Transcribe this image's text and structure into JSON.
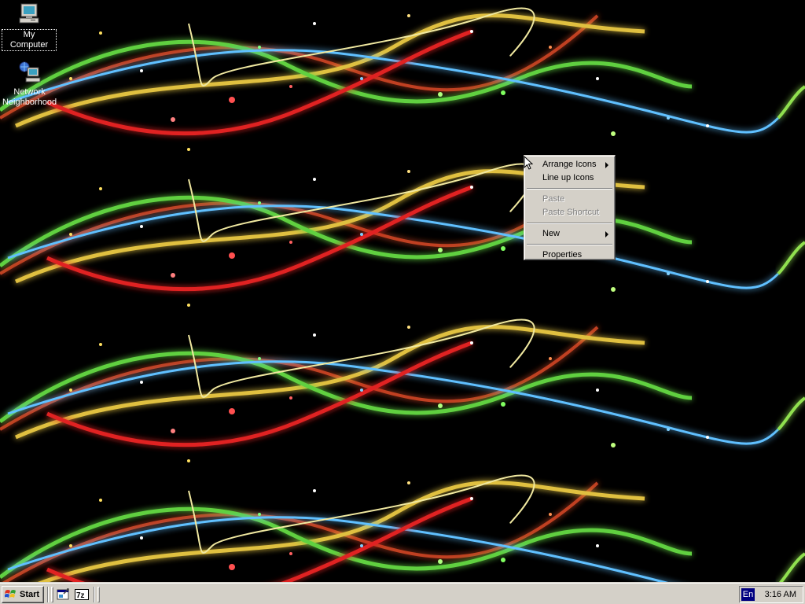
{
  "desktop": {
    "icons": [
      {
        "label": "My Computer",
        "icon": "my-computer-icon",
        "selected": true
      },
      {
        "label": "Network Neighborhood",
        "icon": "network-neighborhood-icon",
        "selected": false
      }
    ]
  },
  "context_menu": {
    "items": {
      "arrange_icons": {
        "label": "Arrange Icons",
        "submenu": true,
        "enabled": true
      },
      "line_up_icons": {
        "label": "Line up Icons",
        "enabled": true
      },
      "paste": {
        "label": "Paste",
        "enabled": false
      },
      "paste_shortcut": {
        "label": "Paste Shortcut",
        "enabled": false
      },
      "new": {
        "label": "New",
        "submenu": true,
        "enabled": true
      },
      "properties": {
        "label": "Properties",
        "enabled": true
      }
    }
  },
  "taskbar": {
    "start_label": "Start",
    "quick_launch": [
      {
        "icon": "show-desktop-icon"
      },
      {
        "icon": "7zip-icon",
        "label": "7z"
      }
    ],
    "tray": {
      "language": "En",
      "clock": "3:16 AM"
    }
  },
  "colors": {
    "desktop_background": "#000000",
    "taskbar": "#d4d0c8",
    "menu_background": "#d4d0c8",
    "language_indicator": "#000080",
    "disabled_text": "#808080"
  }
}
